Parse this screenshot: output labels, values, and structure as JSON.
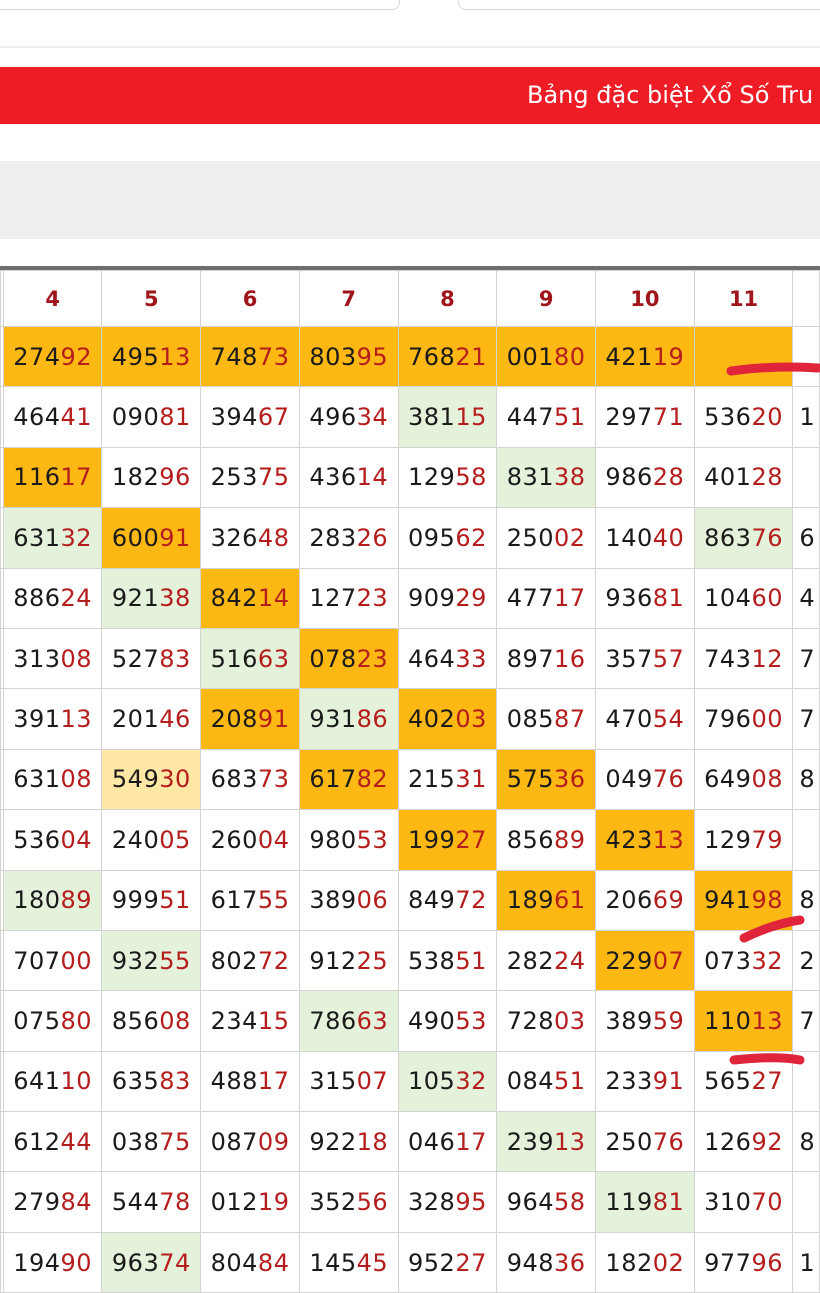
{
  "banner": {
    "text": "Bảng đặc biệt Xổ Số Tru"
  },
  "table": {
    "headers": [
      "4",
      "5",
      "6",
      "7",
      "8",
      "9",
      "10",
      "11"
    ],
    "rows": [
      [
        [
          "27492",
          "o"
        ],
        [
          "49513",
          "o"
        ],
        [
          "74873",
          "o"
        ],
        [
          "80395",
          "o"
        ],
        [
          "76821",
          "o"
        ],
        [
          "00180",
          "o"
        ],
        [
          "42119",
          "o"
        ],
        [
          "",
          "o"
        ]
      ],
      [
        [
          "46441",
          ""
        ],
        [
          "09081",
          ""
        ],
        [
          "39467",
          ""
        ],
        [
          "49634",
          ""
        ],
        [
          "38115",
          "g"
        ],
        [
          "44751",
          ""
        ],
        [
          "29771",
          ""
        ],
        [
          "53620",
          ""
        ]
      ],
      [
        [
          "11617",
          "o"
        ],
        [
          "18296",
          ""
        ],
        [
          "25375",
          ""
        ],
        [
          "43614",
          ""
        ],
        [
          "12958",
          ""
        ],
        [
          "83138",
          "g"
        ],
        [
          "98628",
          ""
        ],
        [
          "40128",
          ""
        ]
      ],
      [
        [
          "63132",
          "g"
        ],
        [
          "60091",
          "o"
        ],
        [
          "32648",
          ""
        ],
        [
          "28326",
          ""
        ],
        [
          "09562",
          ""
        ],
        [
          "25002",
          ""
        ],
        [
          "14040",
          ""
        ],
        [
          "86376",
          "g"
        ]
      ],
      [
        [
          "88624",
          ""
        ],
        [
          "92138",
          "g"
        ],
        [
          "84214",
          "o"
        ],
        [
          "12723",
          ""
        ],
        [
          "90929",
          ""
        ],
        [
          "47717",
          ""
        ],
        [
          "93681",
          ""
        ],
        [
          "10460",
          ""
        ]
      ],
      [
        [
          "31308",
          ""
        ],
        [
          "52783",
          ""
        ],
        [
          "51663",
          "g"
        ],
        [
          "07823",
          "o"
        ],
        [
          "46433",
          ""
        ],
        [
          "89716",
          ""
        ],
        [
          "35757",
          ""
        ],
        [
          "74312",
          ""
        ]
      ],
      [
        [
          "39113",
          ""
        ],
        [
          "20146",
          ""
        ],
        [
          "20891",
          "o"
        ],
        [
          "93186",
          "g"
        ],
        [
          "40203",
          "o"
        ],
        [
          "08587",
          ""
        ],
        [
          "47054",
          ""
        ],
        [
          "79600",
          ""
        ]
      ],
      [
        [
          "63108",
          ""
        ],
        [
          "54930",
          "c"
        ],
        [
          "68373",
          ""
        ],
        [
          "61782",
          "o"
        ],
        [
          "21531",
          ""
        ],
        [
          "57536",
          "o"
        ],
        [
          "04976",
          ""
        ],
        [
          "64908",
          ""
        ]
      ],
      [
        [
          "53604",
          ""
        ],
        [
          "24005",
          ""
        ],
        [
          "26004",
          ""
        ],
        [
          "98053",
          ""
        ],
        [
          "19927",
          "o"
        ],
        [
          "85689",
          ""
        ],
        [
          "42313",
          "o"
        ],
        [
          "12979",
          ""
        ]
      ],
      [
        [
          "18089",
          "g"
        ],
        [
          "99951",
          ""
        ],
        [
          "61755",
          ""
        ],
        [
          "38906",
          ""
        ],
        [
          "84972",
          ""
        ],
        [
          "18961",
          "o"
        ],
        [
          "20669",
          ""
        ],
        [
          "94198",
          "o"
        ]
      ],
      [
        [
          "70700",
          ""
        ],
        [
          "93255",
          "g"
        ],
        [
          "80272",
          ""
        ],
        [
          "91225",
          ""
        ],
        [
          "53851",
          ""
        ],
        [
          "28224",
          ""
        ],
        [
          "22907",
          "o"
        ],
        [
          "07332",
          ""
        ]
      ],
      [
        [
          "07580",
          ""
        ],
        [
          "85608",
          ""
        ],
        [
          "23415",
          ""
        ],
        [
          "78663",
          "g"
        ],
        [
          "49053",
          ""
        ],
        [
          "72803",
          ""
        ],
        [
          "38959",
          ""
        ],
        [
          "11013",
          "o"
        ]
      ],
      [
        [
          "64110",
          ""
        ],
        [
          "63583",
          ""
        ],
        [
          "48817",
          ""
        ],
        [
          "31507",
          ""
        ],
        [
          "10532",
          "g"
        ],
        [
          "08451",
          ""
        ],
        [
          "23391",
          ""
        ],
        [
          "56527",
          ""
        ]
      ],
      [
        [
          "61244",
          ""
        ],
        [
          "03875",
          ""
        ],
        [
          "08709",
          ""
        ],
        [
          "92218",
          ""
        ],
        [
          "04617",
          ""
        ],
        [
          "23913",
          "g"
        ],
        [
          "25076",
          ""
        ],
        [
          "12692",
          ""
        ]
      ],
      [
        [
          "27984",
          ""
        ],
        [
          "54478",
          ""
        ],
        [
          "01219",
          ""
        ],
        [
          "35256",
          ""
        ],
        [
          "32895",
          ""
        ],
        [
          "96458",
          ""
        ],
        [
          "11981",
          "g"
        ],
        [
          "31070",
          ""
        ]
      ],
      [
        [
          "19490",
          ""
        ],
        [
          "96374",
          "g"
        ],
        [
          "80484",
          ""
        ],
        [
          "14545",
          ""
        ],
        [
          "95227",
          ""
        ],
        [
          "94836",
          ""
        ],
        [
          "18202",
          ""
        ],
        [
          "97796",
          ""
        ]
      ]
    ],
    "edge_glyphs": [
      "",
      "",
      "1",
      "",
      "6",
      "4",
      "7",
      "7",
      "8",
      "",
      "8",
      "2",
      "7",
      "",
      "8",
      "",
      "1"
    ]
  },
  "colors": {
    "banner": "#ee1c25",
    "highlight_orange": "#fdb813",
    "highlight_green": "#e4f2dc",
    "highlight_cream": "#ffe7a6",
    "header_text": "#a0151b",
    "tail_text": "#b51d1d",
    "pen_marks": "#e0243a"
  }
}
